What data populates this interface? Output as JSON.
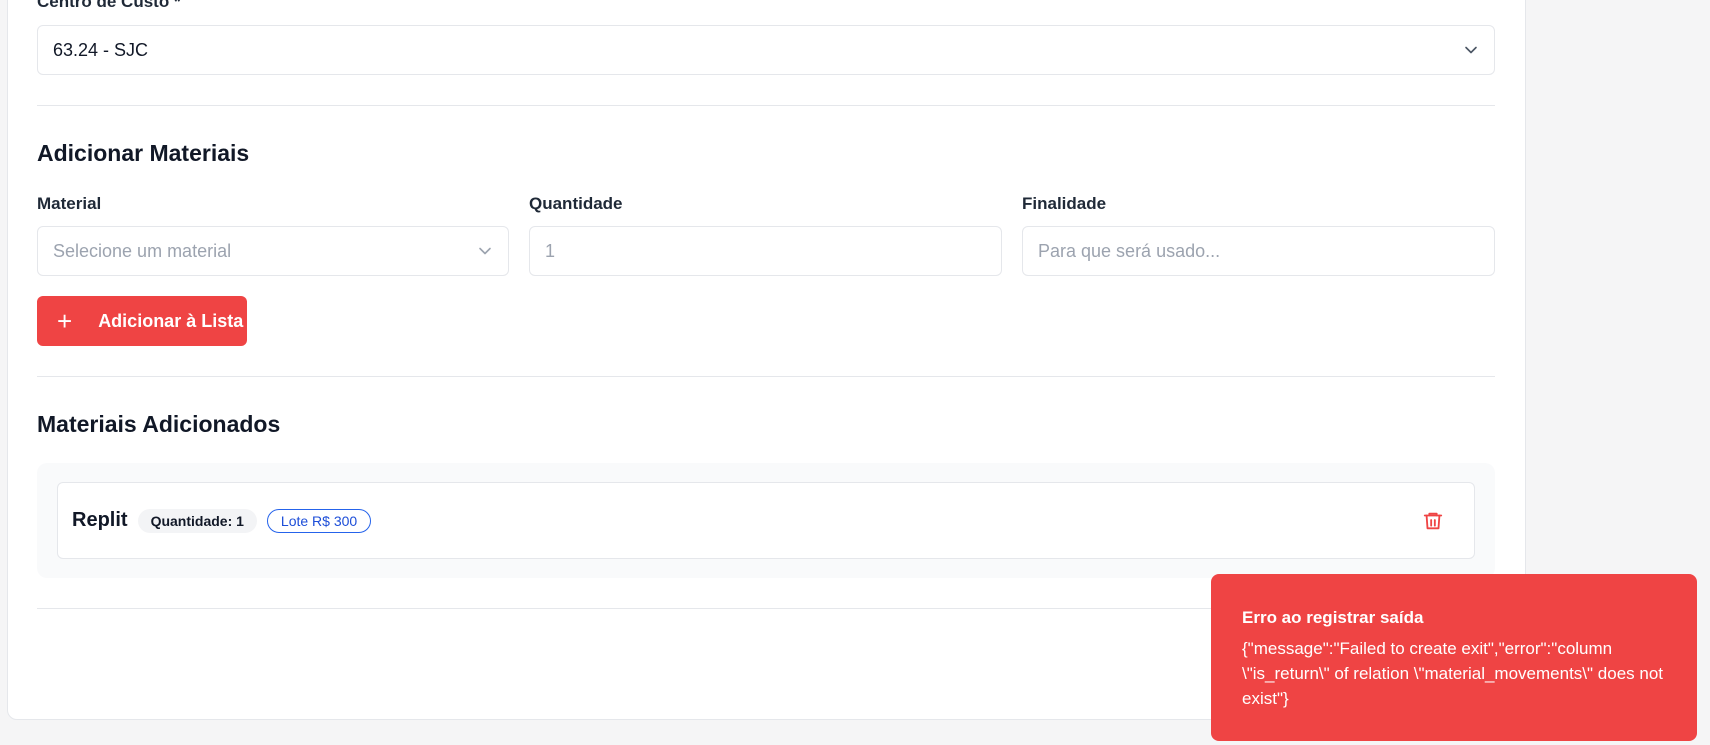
{
  "cost_center": {
    "label": "Centro de Custo *",
    "value": "63.24 - SJC"
  },
  "add_materials": {
    "title": "Adicionar Materiais",
    "material_label": "Material",
    "material_placeholder": "Selecione um material",
    "quantity_label": "Quantidade",
    "quantity_value": "1",
    "purpose_label": "Finalidade",
    "purpose_placeholder": "Para que será usado...",
    "add_button_label": "Adicionar à Lista"
  },
  "added_materials": {
    "title": "Materiais Adicionados",
    "items": [
      {
        "name": "Replit",
        "quantity": "Quantidade: 1",
        "lot": "Lote R$ 300"
      }
    ]
  },
  "toast": {
    "title": "Erro ao registrar saída",
    "message": "{\"message\":\"Failed to create exit\",\"error\":\"column \\\"is_return\\\" of relation \\\"material_movements\\\" does not exist\"}"
  },
  "colors": {
    "primary": "#ef4444",
    "badge_blue": "#2563eb"
  }
}
